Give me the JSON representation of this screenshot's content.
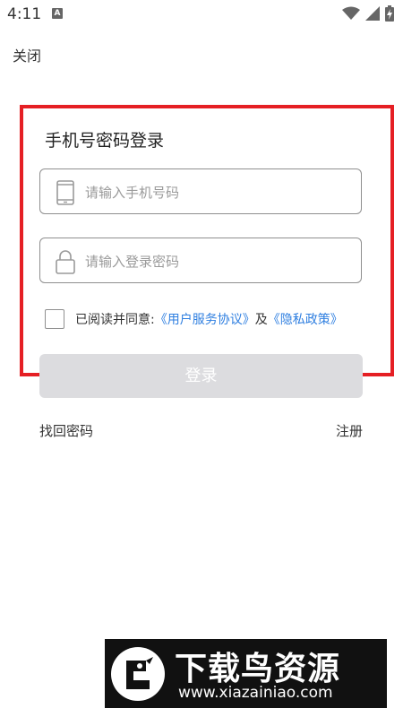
{
  "status_bar": {
    "time": "4:11",
    "notification_badge": "A"
  },
  "header": {
    "close_label": "关闭"
  },
  "login": {
    "title": "手机号密码登录",
    "phone_placeholder": "请输入手机号码",
    "password_placeholder": "请输入登录密码",
    "agree_prefix": "已阅读并同意:",
    "user_agreement": "《用户服务协议》",
    "and": "及",
    "privacy_policy": "《隐私政策》",
    "button_label": "登录"
  },
  "footer_links": {
    "forgot_password": "找回密码",
    "register": "注册"
  },
  "watermark": {
    "title": "下载鸟资源",
    "url": "www.xiazainiao.com"
  },
  "colors": {
    "highlight_border": "#e51f24",
    "link": "#2f7fe0",
    "button_disabled": "#dcdcdf"
  }
}
